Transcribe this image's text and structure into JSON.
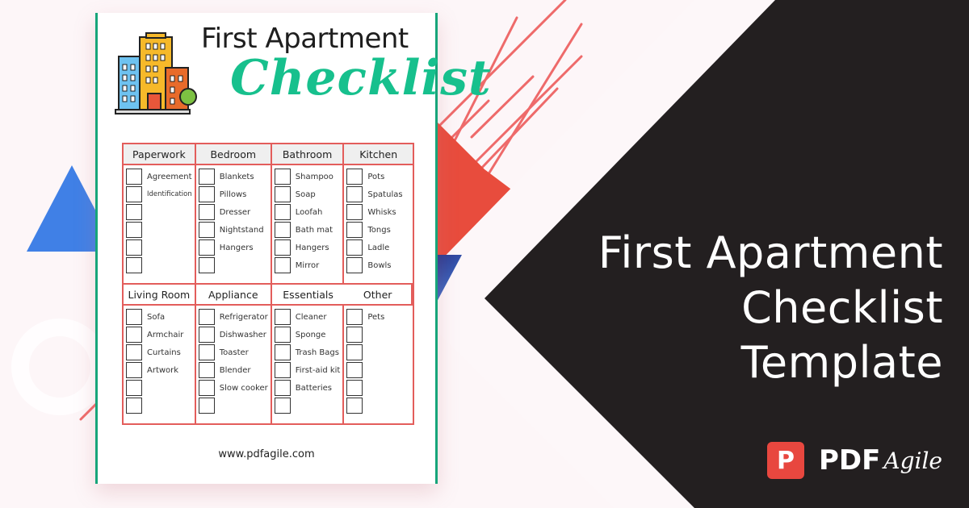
{
  "hero": {
    "lines": [
      "First Apartment",
      "Checklist",
      "Template"
    ]
  },
  "brand": {
    "icon_letter": "P",
    "name_bold": "PDF",
    "name_script": "Agile",
    "icon_color": "#e8473f"
  },
  "document": {
    "title": "First Apartment",
    "subtitle": "Checklist",
    "illustration": "apartment-buildings-icon",
    "footer_url": "www.pdfagile.com",
    "accent_color": "#17c08d",
    "grid_color": "#e35d5b",
    "sections_top": [
      {
        "heading": "Paperwork",
        "items": [
          "Agreement",
          "Identification",
          "",
          "",
          "",
          ""
        ]
      },
      {
        "heading": "Bedroom",
        "items": [
          "Blankets",
          "Pillows",
          "Dresser",
          "Nightstand",
          "Hangers",
          ""
        ]
      },
      {
        "heading": "Bathroom",
        "items": [
          "Shampoo",
          "Soap",
          "Loofah",
          "Bath mat",
          "Hangers",
          "Mirror"
        ]
      },
      {
        "heading": "Kitchen",
        "items": [
          "Pots",
          "Spatulas",
          "Whisks",
          "Tongs",
          "Ladle",
          "Bowls"
        ]
      }
    ],
    "sections_bottom": [
      {
        "heading": "Living Room",
        "items": [
          "Sofa",
          "Armchair",
          "Curtains",
          "Artwork",
          "",
          ""
        ]
      },
      {
        "heading": "Appliance",
        "items": [
          "Refrigerator",
          "Dishwasher",
          "Toaster",
          "Blender",
          "Slow cooker",
          ""
        ]
      },
      {
        "heading": "Essentials",
        "items": [
          "Cleaner",
          "Sponge",
          "Trash Bags",
          "First-aid kit",
          "Batteries",
          ""
        ]
      },
      {
        "heading": "Other",
        "items": [
          "Pets",
          "",
          "",
          "",
          "",
          ""
        ]
      }
    ]
  }
}
